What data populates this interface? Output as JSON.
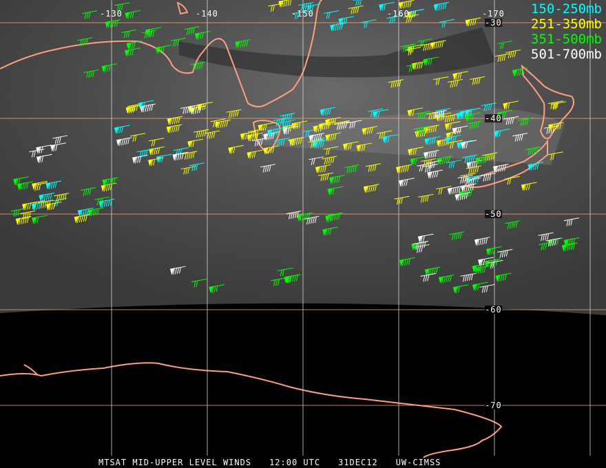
{
  "legend": [
    {
      "label": "150-250mb",
      "color": "#00ffff"
    },
    {
      "label": "251-350mb",
      "color": "#ffff00"
    },
    {
      "label": "351-500mb",
      "color": "#00ff00"
    },
    {
      "label": "501-700mb",
      "color": "#ffffff"
    }
  ],
  "longitude_labels": [
    "-130",
    "-140",
    "-150",
    "-160",
    "-170"
  ],
  "latitude_labels": [
    "-30",
    "-40",
    "-50",
    "-60",
    "-70"
  ],
  "caption": {
    "product": "MTSAT MID-UPPER LEVEL WINDS",
    "time": "12:00 UTC",
    "date": "31DEC12",
    "source": "UW-CIMSS"
  },
  "colors": {
    "coast": "#ff9f7f",
    "grid": "#d8d8d8",
    "grid_lat": "#ffa070"
  }
}
